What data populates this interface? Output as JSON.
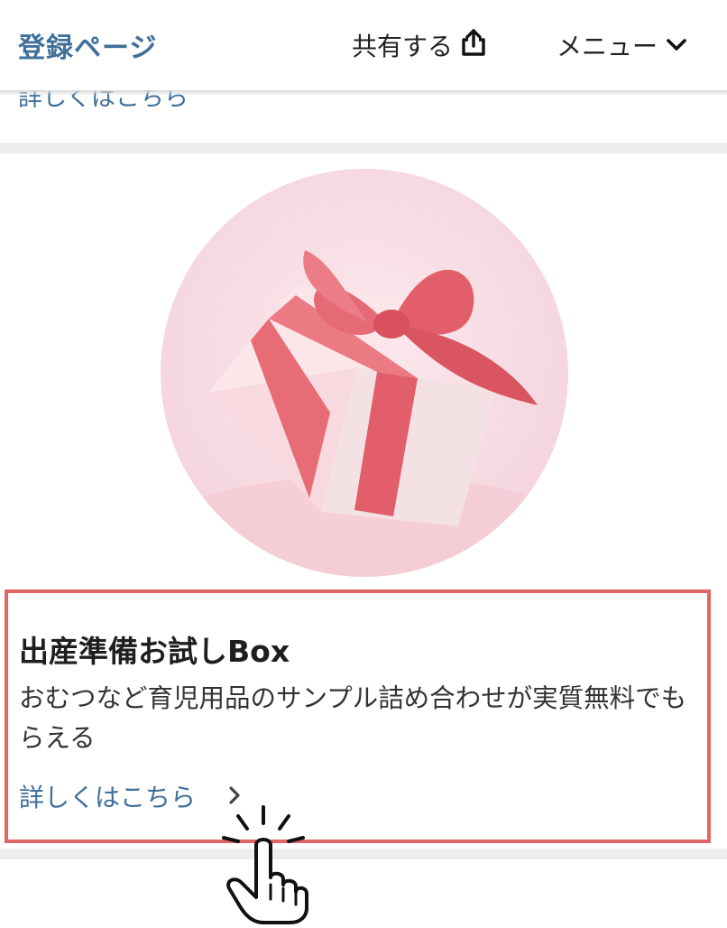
{
  "header": {
    "brand_label": "登録ページ",
    "share_label": "共有する",
    "share_icon": "share-upload-icon",
    "menu_label": "メニュー",
    "menu_icon": "chevron-down-icon"
  },
  "previous_item": {
    "link_label": "詳しくはこちら"
  },
  "card": {
    "image_subject": "gift-box-with-bow",
    "title": "出産準備お試しBox",
    "description": "おむつなど育児用品のサンプル詰め合わせが実質無料でもらえる",
    "link_label": "詳しくはこちら",
    "link_icon": "chevron-right-icon",
    "highlight_color": "#e06666"
  },
  "overlay": {
    "pointer_icon": "tap-hand-pointer-icon"
  },
  "colors": {
    "brand": "#3f6f9a",
    "link": "#3f6f9a",
    "divider": "#ebedee",
    "gift_pink": "#e86c76"
  }
}
